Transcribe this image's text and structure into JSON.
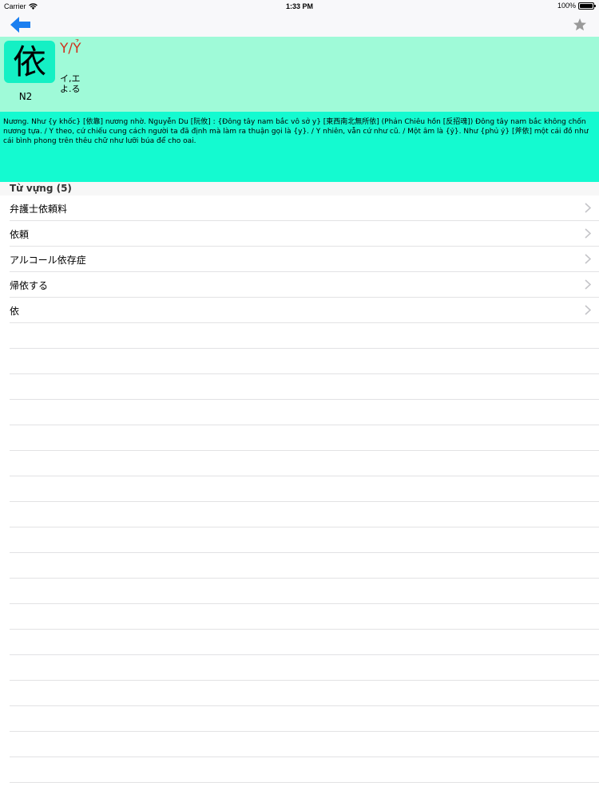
{
  "status_bar": {
    "carrier": "Carrier",
    "time": "1:33 PM",
    "battery": "100%",
    "battery_level": 1.0
  },
  "nav": {
    "back_icon": "back-arrow-icon",
    "star_icon": "star-icon",
    "accent_color": "#1a7ff0"
  },
  "kanji": {
    "character": "依",
    "level": "N2",
    "han_viet": "Y/Ỷ",
    "kun_line1": "イ,エ",
    "kun_line2": "よ.る"
  },
  "meaning": "Nương. Như {y khốc} [依靠] nương nhờ. Nguyễn Du [阮攸] : {Đông tây nam bắc vô sở y} [東西南北無所依] (Phản Chiêu hồn [反招魂]) Đông tây nam bắc không chốn nương tựa. / Y theo, cứ chiếu cung cách người ta đã định mà làm ra thuận gọi là {y}. / Y nhiên, vẫn cứ như cũ. / Một âm là {ỷ}. Như {phủ ỷ} [斧依] một cái đồ như cái bình phong trên thêu chữ như lưỡi búa để cho oai.",
  "vocab": {
    "header": "Từ vựng (5)",
    "items": [
      {
        "word": "弁護士依頼料"
      },
      {
        "word": "依頼"
      },
      {
        "word": "アルコール依存症"
      },
      {
        "word": "帰依する"
      },
      {
        "word": "依"
      }
    ]
  },
  "colors": {
    "header_bg": "#9ffad8",
    "kanji_box": "#14f0c4",
    "meaning_bg": "#14fad0",
    "han_viet": "#d0321e"
  }
}
